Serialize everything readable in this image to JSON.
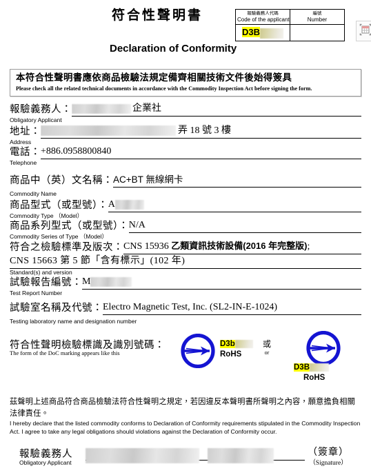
{
  "document": {
    "title_zh": "符合性聲明書",
    "title_en": "Declaration of Conformity"
  },
  "code_table": {
    "col1_zh": "報驗義務人代碼",
    "col1_en": "Code of the applicant",
    "col2_zh": "編號",
    "col2_en": "Number",
    "applicant_code_visible": "D3B",
    "applicant_code_redacted": true,
    "number_value": ""
  },
  "toolbar": {
    "grid_icon": "table-select-icon"
  },
  "notice": {
    "zh": "本符合性聲明書應依商品檢驗法規定備齊相關技術文件後始得簽具",
    "en": "Please check all the related technical documents in accordance with the Commodity Inspection Act before signing the form."
  },
  "fields": {
    "applicant": {
      "label_zh": "報驗義務人：",
      "label_en": "Obligatory Applicant",
      "value_suffix": "企業社",
      "redacted": true
    },
    "address": {
      "label_zh": "地址：",
      "label_en": "Address",
      "value_suffix": "弄 18 號 3 樓",
      "redacted": true
    },
    "telephone": {
      "label_zh": "電話：",
      "label_en": "Telephone",
      "value": "+886.0958800840"
    },
    "commodity_name": {
      "label_zh": "商品中（英）文名稱：",
      "label_en": "Commodity Name",
      "value": "AC+BT 無線網卡"
    },
    "commodity_type": {
      "label_zh": "商品型式（或型號）：",
      "label_en": "Commodity Type （Model）",
      "value_prefix": "A",
      "redacted": true
    },
    "commodity_series": {
      "label_zh": "商品系列型式（或型號）：",
      "label_en": "Commodity Series of Type （Model）",
      "value": "N/A"
    },
    "standards": {
      "label_zh": "符合之檢驗標準及版次：",
      "label_en": "Standard(s) and version",
      "line1_a": "CNS 15936 ",
      "line1_b": "乙類資訊技術設備(2016 年完整版)",
      "line1_c": ";",
      "line2": "CNS 15663 第 5 節「含有標示」(102 年)"
    },
    "test_report": {
      "label_zh": "試驗報告編號：",
      "label_en": "Test Report Number",
      "value_prefix": "M",
      "redacted": true
    },
    "lab": {
      "label_zh": "試驗室名稱及代號：",
      "label_en": "Testing laboratory name and designation number",
      "value": "Electro Magnetic Test, Inc. (SL2-IN-E-1024)"
    }
  },
  "marking": {
    "label_zh": "符合性聲明檢驗標識及識別號碼：",
    "label_en": "The form of the DoC marking appears like this",
    "logo_icon": "bsmi-commodity-inspection-mark-icon",
    "logo_color": "#1414d2",
    "mark_a_code_visible": "D3b",
    "mark_a_rohs": "RoHS",
    "mark_a_redacted": true,
    "or_zh": "或",
    "or_en": "or",
    "mark_b_code_visible": "D3B",
    "mark_b_rohs": "RoHS",
    "mark_b_redacted": true
  },
  "declaration": {
    "zh_line1": "茲聲明上述商品符合商品檢驗法符合性聲明之規定，若因違反本聲明書所聲明之內容，願意擔負相關",
    "zh_line2": "法律責任。",
    "en": "I hereby declare that the listed commodity conforms to Declaration of Conformity requirements stipulated in the Commodity Inspection Act. I agree to take any legal obligations should violations against the Declaration of Conformity occur."
  },
  "signature": {
    "label_zh": "報驗義務人",
    "label_en": "Obligatory Applicant",
    "paren_zh": "（簽章）",
    "paren_en": "（Signature）",
    "redacted": true
  },
  "colors": {
    "highlight": "#ffff00",
    "logo_blue": "#1414d2",
    "rule": "#000000"
  }
}
